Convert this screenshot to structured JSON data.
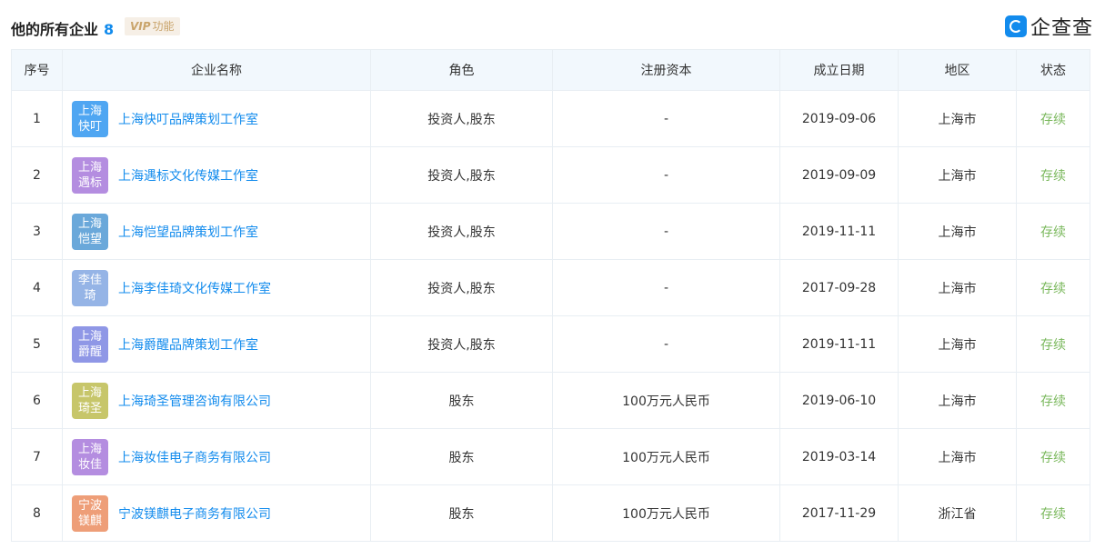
{
  "header": {
    "title": "他的所有企业",
    "count": "8",
    "vip_mark": "VIP",
    "vip_label": "功能",
    "brand": "企查查"
  },
  "columns": [
    "序号",
    "企业名称",
    "角色",
    "注册资本",
    "成立日期",
    "地区",
    "状态"
  ],
  "rows": [
    {
      "index": "1",
      "logo": "上海快叮",
      "logo_color": "#4fa6f2",
      "name": "上海快叮品牌策划工作室",
      "role": "投资人,股东",
      "capital": "-",
      "date": "2019-09-06",
      "region": "上海市",
      "status": "存续"
    },
    {
      "index": "2",
      "logo": "上海遇标",
      "logo_color": "#b48de0",
      "name": "上海遇标文化传媒工作室",
      "role": "投资人,股东",
      "capital": "-",
      "date": "2019-09-09",
      "region": "上海市",
      "status": "存续"
    },
    {
      "index": "3",
      "logo": "上海恺望",
      "logo_color": "#6aa8da",
      "name": "上海恺望品牌策划工作室",
      "role": "投资人,股东",
      "capital": "-",
      "date": "2019-11-11",
      "region": "上海市",
      "status": "存续"
    },
    {
      "index": "4",
      "logo": "李佳琦",
      "logo_color": "#95b4e6",
      "name": "上海李佳琦文化传媒工作室",
      "role": "投资人,股东",
      "capital": "-",
      "date": "2017-09-28",
      "region": "上海市",
      "status": "存续"
    },
    {
      "index": "5",
      "logo": "上海爵醒",
      "logo_color": "#8f97e6",
      "name": "上海爵醒品牌策划工作室",
      "role": "投资人,股东",
      "capital": "-",
      "date": "2019-11-11",
      "region": "上海市",
      "status": "存续"
    },
    {
      "index": "6",
      "logo": "上海琦圣",
      "logo_color": "#c7c66a",
      "name": "上海琦圣管理咨询有限公司",
      "role": "股东",
      "capital": "100万元人民币",
      "date": "2019-06-10",
      "region": "上海市",
      "status": "存续"
    },
    {
      "index": "7",
      "logo": "上海妆佳",
      "logo_color": "#b48de0",
      "name": "上海妆佳电子商务有限公司",
      "role": "股东",
      "capital": "100万元人民币",
      "date": "2019-03-14",
      "region": "上海市",
      "status": "存续"
    },
    {
      "index": "8",
      "logo": "宁波镁麒",
      "logo_color": "#ee9e78",
      "name": "宁波镁麒电子商务有限公司",
      "role": "股东",
      "capital": "100万元人民币",
      "date": "2017-11-29",
      "region": "浙江省",
      "status": "存续"
    }
  ]
}
